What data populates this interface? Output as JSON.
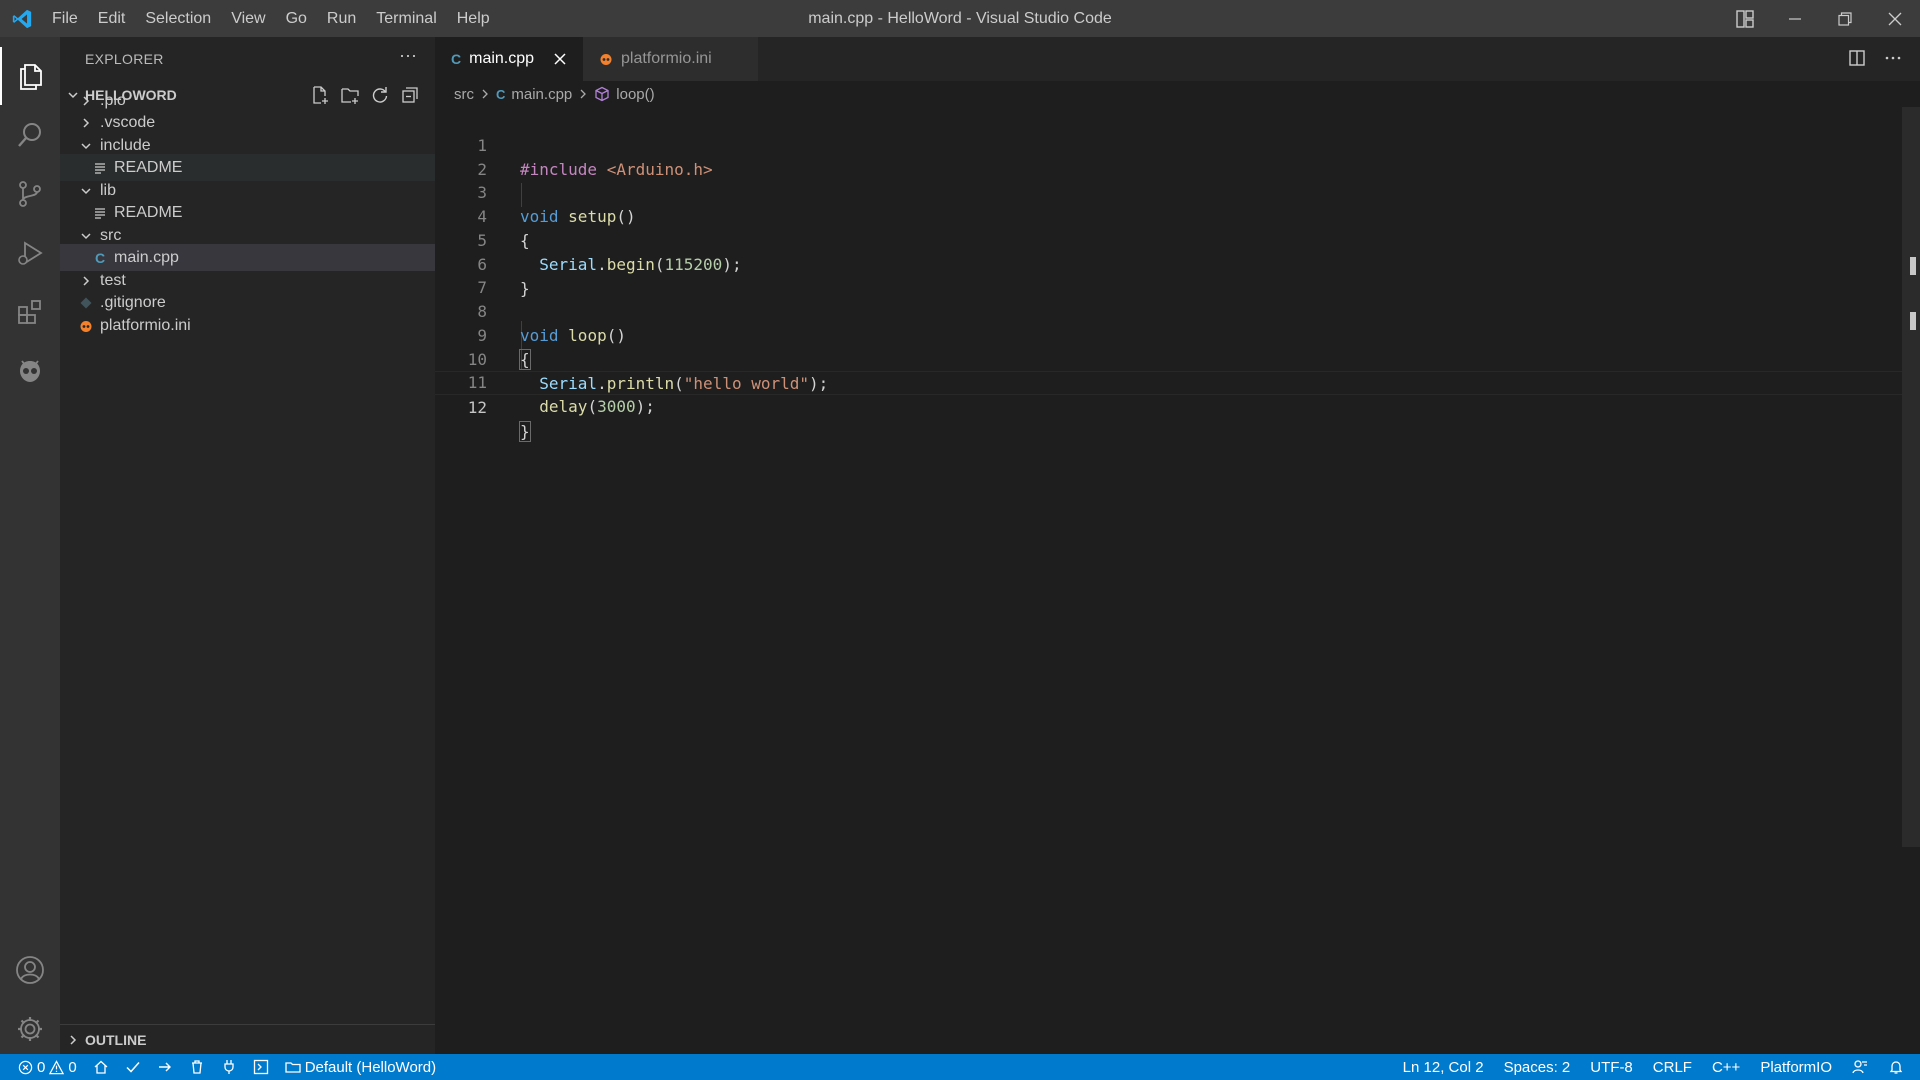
{
  "window": {
    "title": "main.cpp - HelloWord - Visual Studio Code",
    "menu": [
      "File",
      "Edit",
      "Selection",
      "View",
      "Go",
      "Run",
      "Terminal",
      "Help"
    ]
  },
  "sidebar": {
    "title": "EXPLORER",
    "more": "···",
    "project": "HELLOWORD",
    "tree": [
      {
        "label": ".pio"
      },
      {
        "label": ".vscode"
      },
      {
        "label": "include"
      },
      {
        "label": "README"
      },
      {
        "label": "lib"
      },
      {
        "label": "README"
      },
      {
        "label": "src"
      },
      {
        "label": "main.cpp"
      },
      {
        "label": "test"
      },
      {
        "label": ".gitignore"
      },
      {
        "label": "platformio.ini"
      }
    ],
    "outline": "OUTLINE"
  },
  "tabs": [
    {
      "label": "main.cpp",
      "icon": "C"
    },
    {
      "label": "platformio.ini"
    }
  ],
  "breadcrumb": [
    "src",
    "main.cpp",
    "loop()"
  ],
  "editor": {
    "line_numbers": [
      "1",
      "2",
      "3",
      "4",
      "5",
      "6",
      "7",
      "8",
      "9",
      "10",
      "11",
      "12"
    ],
    "current_line": 12,
    "code": {
      "l1_inc": "#include",
      "l1_hdr": "<Arduino.h>",
      "l3_kw": "void",
      "l3_fn": "setup",
      "l3_p": "()",
      "l4": "{",
      "l5_obj": "Serial",
      "l5_dot": ".",
      "l5_fn": "begin",
      "l5_open": "(",
      "l5_num": "115200",
      "l5_close": ");",
      "l6": "}",
      "l8_kw": "void",
      "l8_fn": "loop",
      "l8_p": "()",
      "l9": "{",
      "l10_obj": "Serial",
      "l10_dot": ".",
      "l10_fn": "println",
      "l10_open": "(",
      "l10_str": "\"hello world\"",
      "l10_close": ");",
      "l11_fn": "delay",
      "l11_open": "(",
      "l11_num": "3000",
      "l11_close": ");",
      "l12": "}"
    }
  },
  "statusbar": {
    "errors": "0",
    "warnings": "0",
    "env": "Default (HelloWord)",
    "position": "Ln 12, Col 2",
    "spaces": "Spaces: 2",
    "encoding": "UTF-8",
    "eol": "CRLF",
    "language": "C++",
    "platform": "PlatformIO"
  },
  "colors": {
    "statusbar": "#007acc",
    "activitybar": "#333333",
    "sidebar": "#252526",
    "editor": "#1e1e1e",
    "titlebar": "#3c3c3c"
  }
}
